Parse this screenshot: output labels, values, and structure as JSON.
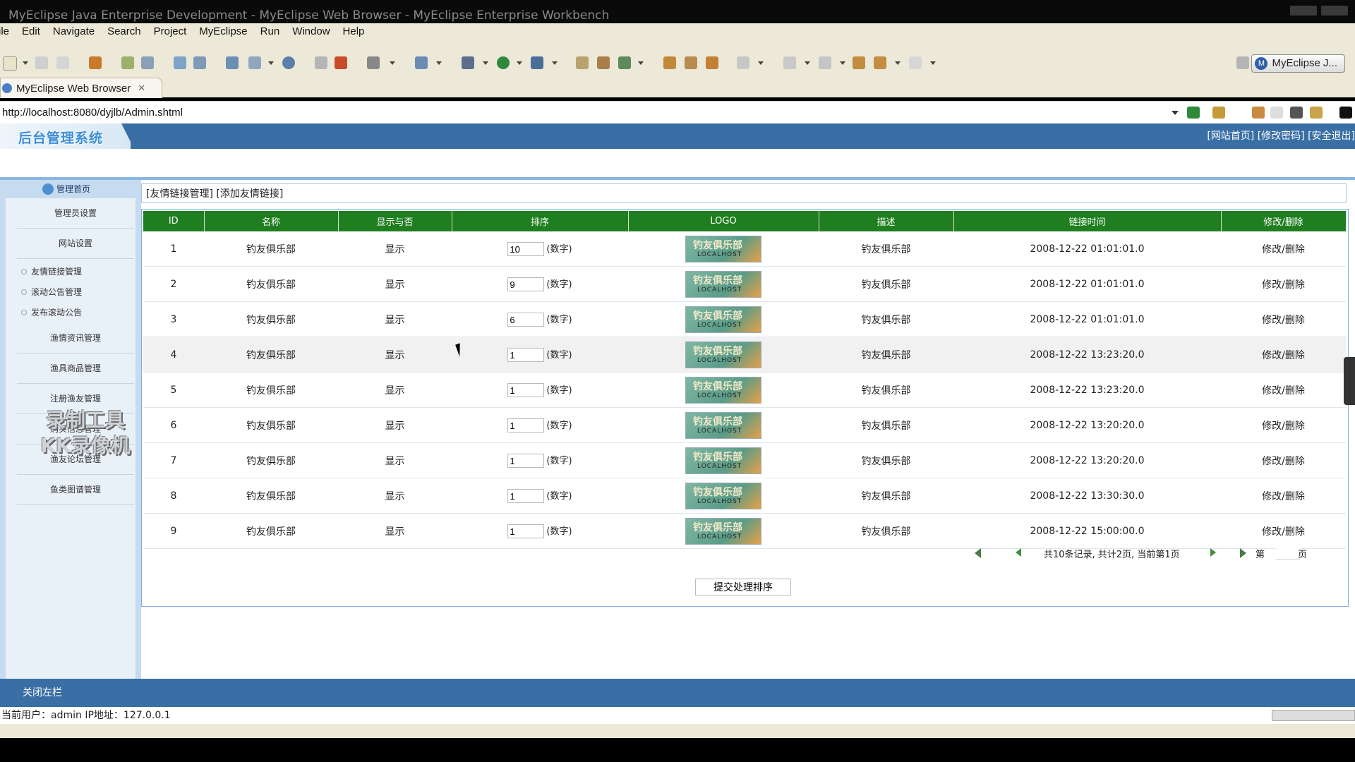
{
  "window": {
    "title": "MyEclipse Java Enterprise Development - MyEclipse Web Browser - MyEclipse Enterprise Workbench"
  },
  "menu": [
    "ile",
    "Edit",
    "Navigate",
    "Search",
    "Project",
    "MyEclipse",
    "Run",
    "Window",
    "Help"
  ],
  "perspective": {
    "label": "MyEclipse J..."
  },
  "editor_tab": {
    "label": "MyEclipse Web Browser",
    "close": "✕"
  },
  "address": {
    "url": "http://localhost:8080/dyjlb/Admin.shtml"
  },
  "app": {
    "logo_text": "后台管理系统",
    "top_links": "[网站首页] [修改密码] [安全退出]"
  },
  "sidebar": {
    "home": "管理首页",
    "items": [
      "管理员设置",
      "网站设置"
    ],
    "subitems": [
      "友情链接管理",
      "滚动公告管理",
      "发布滚动公告"
    ],
    "items2": [
      "渔情资讯管理",
      "渔具商品管理",
      "注册渔友管理",
      "购买信息管理",
      "渔友论坛管理",
      "鱼类图谱管理"
    ],
    "watermark_line1": "录制工具",
    "watermark_line2": "KK录像机"
  },
  "breadcrumb": "[友情链接管理] [添加友情链接]",
  "table": {
    "headers": [
      "ID",
      "名称",
      "显示与否",
      "排序",
      "LOGO",
      "描述",
      "链接时间",
      "修改/删除"
    ],
    "num_hint": "(数字)",
    "logo_text": "钓友俱乐部",
    "logo_sub": "LOCALHOST",
    "rows": [
      {
        "id": "1",
        "name": "钓友俱乐部",
        "show": "显示",
        "sort": "10",
        "desc": "钓友俱乐部",
        "time": "2008-12-22 01:01:01.0",
        "action": "修改/删除"
      },
      {
        "id": "2",
        "name": "钓友俱乐部",
        "show": "显示",
        "sort": "9",
        "desc": "钓友俱乐部",
        "time": "2008-12-22 01:01:01.0",
        "action": "修改/删除"
      },
      {
        "id": "3",
        "name": "钓友俱乐部",
        "show": "显示",
        "sort": "6",
        "desc": "钓友俱乐部",
        "time": "2008-12-22 01:01:01.0",
        "action": "修改/删除"
      },
      {
        "id": "4",
        "name": "钓友俱乐部",
        "show": "显示",
        "sort": "1",
        "desc": "钓友俱乐部",
        "time": "2008-12-22 13:23:20.0",
        "action": "修改/删除"
      },
      {
        "id": "5",
        "name": "钓友俱乐部",
        "show": "显示",
        "sort": "1",
        "desc": "钓友俱乐部",
        "time": "2008-12-22 13:23:20.0",
        "action": "修改/删除"
      },
      {
        "id": "6",
        "name": "钓友俱乐部",
        "show": "显示",
        "sort": "1",
        "desc": "钓友俱乐部",
        "time": "2008-12-22 13:20:20.0",
        "action": "修改/删除"
      },
      {
        "id": "7",
        "name": "钓友俱乐部",
        "show": "显示",
        "sort": "1",
        "desc": "钓友俱乐部",
        "time": "2008-12-22 13:20:20.0",
        "action": "修改/删除"
      },
      {
        "id": "8",
        "name": "钓友俱乐部",
        "show": "显示",
        "sort": "1",
        "desc": "钓友俱乐部",
        "time": "2008-12-22 13:30:30.0",
        "action": "修改/删除"
      },
      {
        "id": "9",
        "name": "钓友俱乐部",
        "show": "显示",
        "sort": "1",
        "desc": "钓友俱乐部",
        "time": "2008-12-22 15:00:00.0",
        "action": "修改/删除"
      }
    ]
  },
  "pager": {
    "summary": "共10条记录, 共计2页, 当前第1页",
    "di": "第",
    "ye": "页"
  },
  "submit_label": "提交处理排序",
  "bottom": {
    "close_left": "关闭左栏"
  },
  "status": {
    "text": "当前用户：admin  IP地址：127.0.0.1"
  },
  "colors": {
    "header_blue": "#3a6fa5",
    "table_green": "#1f7e1f",
    "sidebar_bg": "#e9f1f8"
  }
}
